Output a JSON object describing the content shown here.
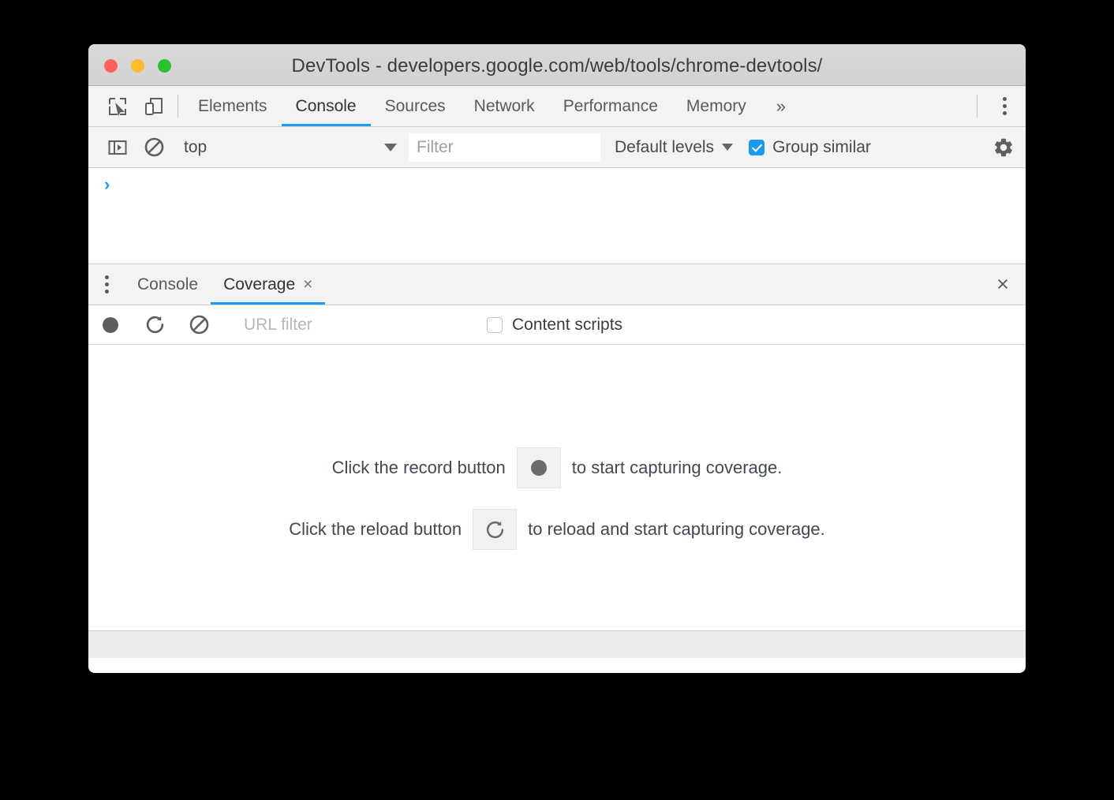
{
  "window": {
    "title": "DevTools - developers.google.com/web/tools/chrome-devtools/",
    "traffic_lights": {
      "close": "close-red",
      "minimize": "minimize-yellow",
      "zoom": "zoom-green"
    },
    "colors": {
      "accent_blue": "#1f9cf0",
      "checkbox_blue": "#1a9bf0",
      "titlebar_gray": "#d6d6d6",
      "toolbar_gray": "#f3f3f3",
      "text_dark": "#3c3c3c",
      "text_muted": "#5a5a5a",
      "traffic_red": "#ff6259",
      "traffic_yellow": "#fdbc2c",
      "traffic_green": "#2ac02e"
    }
  },
  "main_tabbar": {
    "inspect_icon": "inspect-element-icon",
    "device_icon": "device-toolbar-icon",
    "tabs": [
      {
        "label": "Elements",
        "active": false
      },
      {
        "label": "Console",
        "active": true
      },
      {
        "label": "Sources",
        "active": false
      },
      {
        "label": "Network",
        "active": false
      },
      {
        "label": "Performance",
        "active": false
      },
      {
        "label": "Memory",
        "active": false
      }
    ],
    "more_tabs": "»",
    "menu_icon": "more-vertical-icon"
  },
  "console_toolbar": {
    "sidebar_icon": "console-sidebar-icon",
    "clear_icon": "clear-console-icon",
    "context": "top",
    "context_caret": "chevron-down-icon",
    "filter": {
      "value": "",
      "placeholder": "Filter"
    },
    "levels": "Default levels",
    "levels_caret": "chevron-down-icon",
    "group_similar": {
      "label": "Group similar",
      "checked": true
    },
    "settings_icon": "gear-icon"
  },
  "console_output": {
    "prompt": "›"
  },
  "drawer": {
    "menu_icon": "more-vertical-icon",
    "tabs": [
      {
        "label": "Console",
        "active": false,
        "closable": false
      },
      {
        "label": "Coverage",
        "active": true,
        "closable": true,
        "close": "×"
      }
    ],
    "close": "×"
  },
  "coverage_toolbar": {
    "record_icon": "record-icon",
    "reload_icon": "reload-icon",
    "clear_icon": "clear-icon",
    "url_filter": {
      "value": "",
      "placeholder": "URL filter"
    },
    "content_scripts": {
      "label": "Content scripts",
      "checked": false
    }
  },
  "coverage_body": {
    "hints": [
      {
        "prefix": "Click the record button",
        "icon": "record-icon",
        "suffix": "to start capturing coverage."
      },
      {
        "prefix": "Click the reload button",
        "icon": "reload-icon",
        "suffix": "to reload and start capturing coverage."
      }
    ]
  }
}
